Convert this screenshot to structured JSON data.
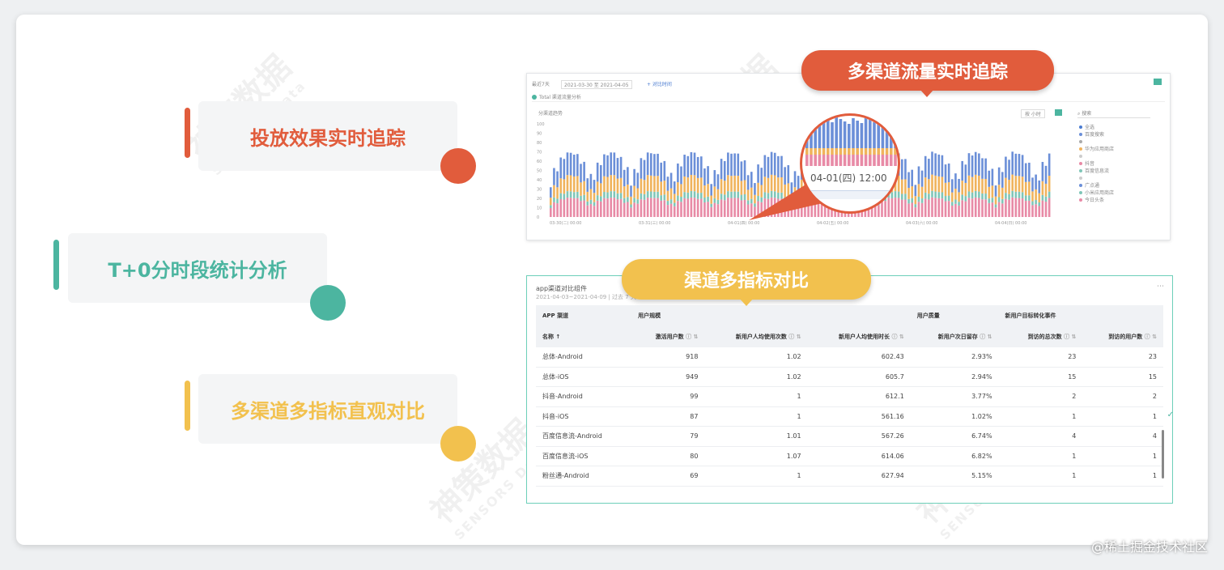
{
  "features": [
    {
      "label": "投放效果实时追踪",
      "color": "#e15c3c"
    },
    {
      "label": "T+0分时段统计分析",
      "color": "#4cb5a0"
    },
    {
      "label": "多渠道多指标直观对比",
      "color": "#f2c14e"
    }
  ],
  "callouts": {
    "traffic": "多渠道流量实时追踪",
    "compare": "渠道多指标对比"
  },
  "chart": {
    "toolbar_left": "最近7天",
    "date_range": "2021-03-30 至 2021-04-05",
    "compare_link": "+ 对比时间",
    "subtitle": "Total 渠道流量分析",
    "panel_title": "分渠道趋势",
    "granularity": "按 小时",
    "search_placeholder": "搜索",
    "zoom_label": "04-01(四) 12:00",
    "y_ticks": [
      "100",
      "90",
      "80",
      "70",
      "60",
      "50",
      "40",
      "30",
      "20",
      "10",
      "0"
    ],
    "x_ticks": [
      "03-30(二) 00:00",
      "03-31(三) 00:00",
      "04-01(四) 00:00",
      "04-02(五) 00:00",
      "04-03(六) 00:00",
      "04-04(日) 00:00"
    ],
    "legend": [
      "全选",
      "百度搜索",
      "",
      "华为应用商店",
      "",
      "抖音",
      "百度信息流",
      "",
      "广点通",
      "小米应用商店",
      "今日头条"
    ],
    "colors": {
      "blue": "#6b8fd8",
      "orange": "#f0b35c",
      "pink": "#e88aa6",
      "teal": "#7fc6b8"
    }
  },
  "table": {
    "title": "app渠道对比组件",
    "date": "2021-04-03~2021-04-09 | 过去 7 天",
    "group_headers": [
      "APP 渠道",
      "用户规模",
      "",
      "",
      "用户质量",
      "新用户目标转化事件",
      ""
    ],
    "columns": [
      "名称 ↑",
      "激活用户数",
      "新用户人均使用次数",
      "新用户人均使用时长",
      "新用户次日留存",
      "到访的总次数",
      "到访的用户数"
    ],
    "rows": [
      [
        "总体-Android",
        "918",
        "1.02",
        "602.43",
        "2.93%",
        "23",
        "23"
      ],
      [
        "总体-iOS",
        "949",
        "1.02",
        "605.7",
        "2.94%",
        "15",
        "15"
      ],
      [
        "抖音-Android",
        "99",
        "1",
        "612.1",
        "3.77%",
        "2",
        "2"
      ],
      [
        "抖音-iOS",
        "87",
        "1",
        "561.16",
        "1.02%",
        "1",
        "1"
      ],
      [
        "百度信息流-Android",
        "79",
        "1.01",
        "567.26",
        "6.74%",
        "4",
        "4"
      ],
      [
        "百度信息流-iOS",
        "80",
        "1.07",
        "614.06",
        "6.82%",
        "1",
        "1"
      ],
      [
        "粉丝通-Android",
        "69",
        "1",
        "627.94",
        "5.15%",
        "1",
        "1"
      ]
    ]
  },
  "watermark": {
    "cn": "神策数据",
    "en": "SENSORS Data"
  },
  "footer": "@稀土掘金技术社区"
}
